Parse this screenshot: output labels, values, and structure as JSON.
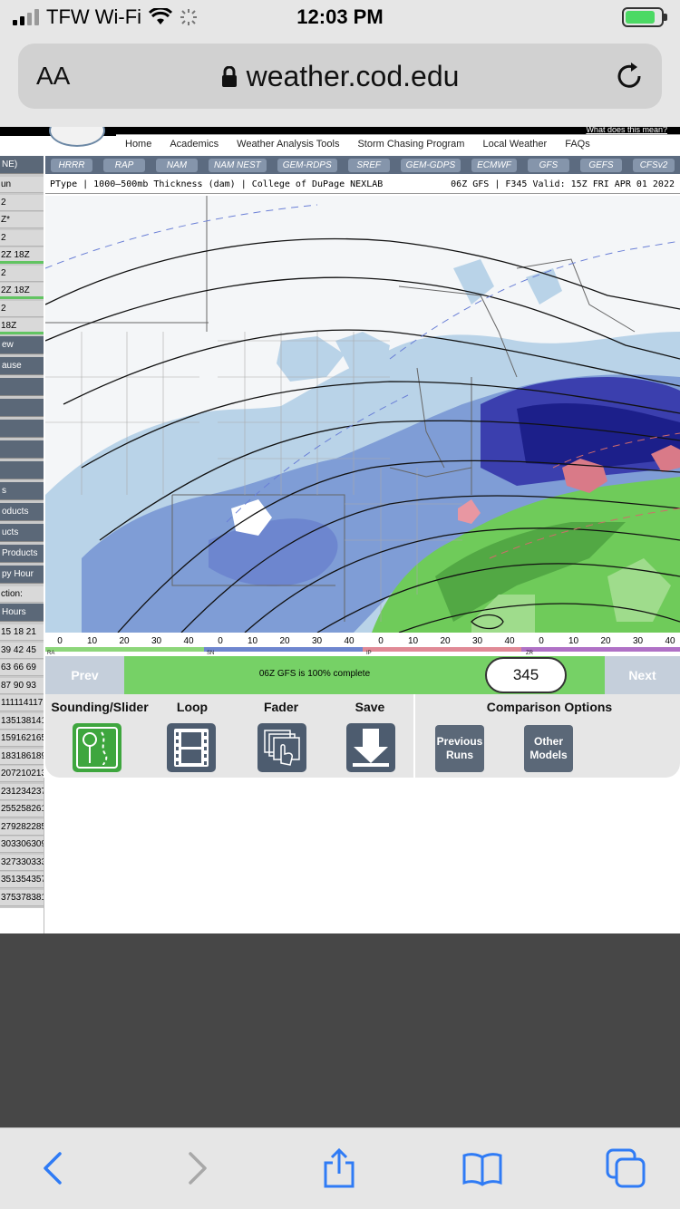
{
  "status": {
    "carrier": "TFW Wi-Fi",
    "time": "12:03 PM"
  },
  "browser": {
    "text_size_label": "AA",
    "url": "weather.cod.edu"
  },
  "site": {
    "top_link": "What does this mean?",
    "nav": [
      "Home",
      "Academics",
      "Weather Analysis Tools",
      "Storm Chasing Program",
      "Local Weather",
      "FAQs"
    ],
    "models": [
      "HRRR",
      "RAP",
      "NAM",
      "NAM NEST",
      "GEM-RDPS",
      "SREF",
      "GEM-GDPS",
      "ECMWF",
      "GFS",
      "GEFS",
      "CFSv2"
    ],
    "map_title_left": "PType | 1000–500mb Thickness (dam) | College of DuPage NEXLAB",
    "map_title_right": "06Z GFS | F345 Valid: 15Z FRI APR 01 2022",
    "scale_ticks": [
      "0",
      "10",
      "20",
      "30",
      "40",
      "0",
      "10",
      "20",
      "30",
      "40",
      "0",
      "10",
      "20",
      "30",
      "40",
      "0",
      "10",
      "20",
      "30",
      "40"
    ],
    "scale_labels": [
      "RA",
      "SN",
      "IP",
      "ZR"
    ]
  },
  "sidebar": {
    "items": [
      {
        "text": "NE)",
        "style": "dark"
      },
      {
        "text": "un",
        "style": "row"
      },
      {
        "text": "2",
        "style": "row"
      },
      {
        "text": "Z*",
        "style": "row"
      },
      {
        "text": "2",
        "style": "row"
      },
      {
        "text": "2Z    18Z",
        "style": "row grn"
      },
      {
        "text": "2",
        "style": "row"
      },
      {
        "text": "2Z    18Z",
        "style": "row grn"
      },
      {
        "text": "2",
        "style": "row"
      },
      {
        "text": "        18Z",
        "style": "row grn"
      },
      {
        "text": "ew",
        "style": "dark"
      },
      {
        "text": "ause",
        "style": "dark"
      },
      {
        "text": "",
        "style": "dark"
      },
      {
        "text": "",
        "style": "dark"
      },
      {
        "text": "",
        "style": "dark"
      },
      {
        "text": "",
        "style": "dark"
      },
      {
        "text": "",
        "style": "dark"
      },
      {
        "text": "s",
        "style": "dark"
      },
      {
        "text": "oducts",
        "style": "dark"
      },
      {
        "text": "ucts",
        "style": "dark"
      },
      {
        "text": "Products",
        "style": "dark"
      },
      {
        "text": "py Hour",
        "style": "dark"
      },
      {
        "text": "ction:",
        "style": "row"
      },
      {
        "text": "Hours",
        "style": "dark"
      },
      {
        "text": "15 18 21",
        "style": "row"
      },
      {
        "text": "39 42 45",
        "style": "row"
      },
      {
        "text": "63 66 69",
        "style": "row"
      },
      {
        "text": "87 90 93",
        "style": "row"
      },
      {
        "text": "111114117",
        "style": "row"
      },
      {
        "text": "135138141",
        "style": "row"
      },
      {
        "text": "159162165",
        "style": "row"
      },
      {
        "text": "183186189",
        "style": "row"
      },
      {
        "text": "207210213",
        "style": "row"
      },
      {
        "text": "231234237",
        "style": "row"
      },
      {
        "text": "255258261",
        "style": "row"
      },
      {
        "text": "279282285",
        "style": "row"
      },
      {
        "text": "303306309",
        "style": "row"
      },
      {
        "text": "327330333",
        "style": "row"
      },
      {
        "text": "351354357",
        "style": "row"
      },
      {
        "text": "375378381",
        "style": "row"
      }
    ]
  },
  "controls": {
    "prev": "Prev",
    "next": "Next",
    "progress_text": "06Z GFS is 100% complete",
    "forecast_hour": "345",
    "tools": {
      "sounding": "Sounding/Slider",
      "loop": "Loop",
      "fader": "Fader",
      "save": "Save",
      "comparison": "Comparison Options",
      "previous_runs": "Previous Runs",
      "other_models": "Other Models"
    }
  },
  "colors": {
    "accent_green": "#76d166",
    "nav_slate": "#5b6878",
    "snow_blue": "#5a6cc8",
    "rain_green": "#6fcb5a"
  }
}
